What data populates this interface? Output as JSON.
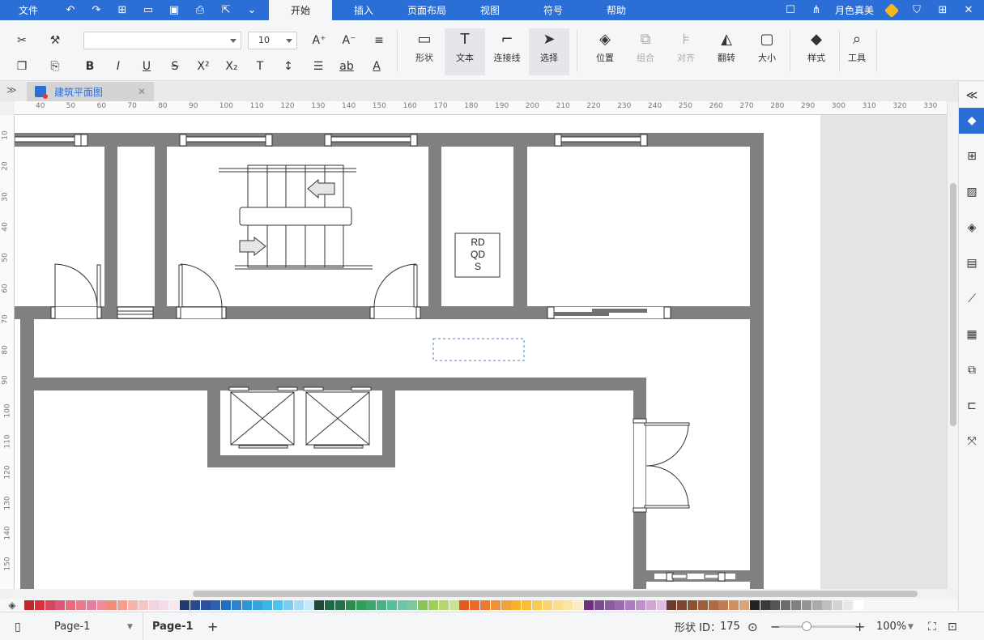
{
  "topbar": {
    "file_label": "文件",
    "quick_icons": [
      "undo-icon",
      "redo-icon",
      "new-icon",
      "open-icon",
      "save-icon",
      "print-icon",
      "export-icon",
      "more-icon"
    ],
    "tabs": [
      {
        "label": "开始",
        "active": true
      },
      {
        "label": "插入",
        "active": false
      },
      {
        "label": "页面布局",
        "active": false
      },
      {
        "label": "视图",
        "active": false
      },
      {
        "label": "符号",
        "active": false
      },
      {
        "label": "帮助",
        "active": false
      }
    ],
    "user_name": "月色真美",
    "accent": "#2b6fd6"
  },
  "ribbon": {
    "font_name": "",
    "font_size": "10",
    "big_buttons": [
      {
        "name": "shape",
        "label": "形状",
        "active": false,
        "disabled": false
      },
      {
        "name": "text",
        "label": "文本",
        "active": true,
        "disabled": false
      },
      {
        "name": "connector",
        "label": "连接线",
        "active": false,
        "disabled": false
      },
      {
        "name": "select",
        "label": "选择",
        "active": false,
        "disabled": false
      },
      {
        "name": "position",
        "label": "位置",
        "active": false,
        "disabled": false
      },
      {
        "name": "group",
        "label": "组合",
        "active": false,
        "disabled": true
      },
      {
        "name": "align",
        "label": "对齐",
        "active": false,
        "disabled": true
      },
      {
        "name": "flip",
        "label": "翻转",
        "active": false,
        "disabled": false
      },
      {
        "name": "size",
        "label": "大小",
        "active": false,
        "disabled": false
      },
      {
        "name": "style",
        "label": "样式",
        "active": false,
        "disabled": false
      },
      {
        "name": "tools",
        "label": "工具",
        "active": false,
        "disabled": false
      }
    ]
  },
  "document": {
    "tab_title": "建筑平面图",
    "elevator_box_text": [
      "RD",
      "QD",
      "S"
    ]
  },
  "rulers": {
    "h": [
      "40",
      "50",
      "60",
      "70",
      "80",
      "90",
      "100",
      "110",
      "120",
      "130",
      "140",
      "150",
      "160",
      "170",
      "180",
      "190",
      "200",
      "210",
      "220",
      "230",
      "240",
      "250",
      "260",
      "270",
      "280",
      "290",
      "300",
      "310",
      "320",
      "330"
    ],
    "v": [
      "10",
      "20",
      "30",
      "40",
      "50",
      "60",
      "70",
      "80",
      "90",
      "100",
      "110",
      "120",
      "130",
      "140",
      "150"
    ]
  },
  "palette": [
    "#c0282c",
    "#d8313a",
    "#d3475f",
    "#e0557a",
    "#e86a7d",
    "#ec7a8d",
    "#e57fa2",
    "#ef8c98",
    "#f28c7a",
    "#f59e8f",
    "#f5b3ac",
    "#f5c7c4",
    "#f2d3e1",
    "#f6dce8",
    "#fbe6ee",
    "#203a6d",
    "#264a8e",
    "#2e4fa0",
    "#2d5fb5",
    "#1f6fc3",
    "#2d83cf",
    "#3094d8",
    "#35a4e0",
    "#39b6e8",
    "#4dc3ef",
    "#79cdf1",
    "#a5dcf5",
    "#c8e8f8",
    "#1f4a3a",
    "#1d6a46",
    "#24704a",
    "#2e8b4d",
    "#2f9e58",
    "#39a870",
    "#49b284",
    "#59bf9a",
    "#6ec5a8",
    "#80c99e",
    "#8bc45a",
    "#9fcf59",
    "#b4d86d",
    "#c9e391",
    "#e05a1f",
    "#e8692a",
    "#ee7a2f",
    "#f28f3a",
    "#f5a03f",
    "#f7b12b",
    "#f8be39",
    "#f9cb55",
    "#fad46f",
    "#fbdd8b",
    "#fbe4a4",
    "#f9edc4",
    "#6e2f7d",
    "#7a4b8e",
    "#8a5da0",
    "#9a6bb0",
    "#ac7ebd",
    "#be92c8",
    "#d1a6d3",
    "#e1bde1",
    "#6a3a2a",
    "#7d4430",
    "#8c5034",
    "#9e5d3b",
    "#b06a43",
    "#c27c53",
    "#cf9063",
    "#d9a478",
    "#222222",
    "#3a3a3a",
    "#555555",
    "#6b6b6b",
    "#808080",
    "#959595",
    "#aaaaaa",
    "#bfbfbf",
    "#d4d4d4",
    "#e9e9e9",
    "#ffffff"
  ],
  "statusbar": {
    "page_select": "Page-1",
    "page_tab": "Page-1",
    "shape_id_label": "形状 ID：",
    "shape_id": "175",
    "zoom": "100%"
  }
}
